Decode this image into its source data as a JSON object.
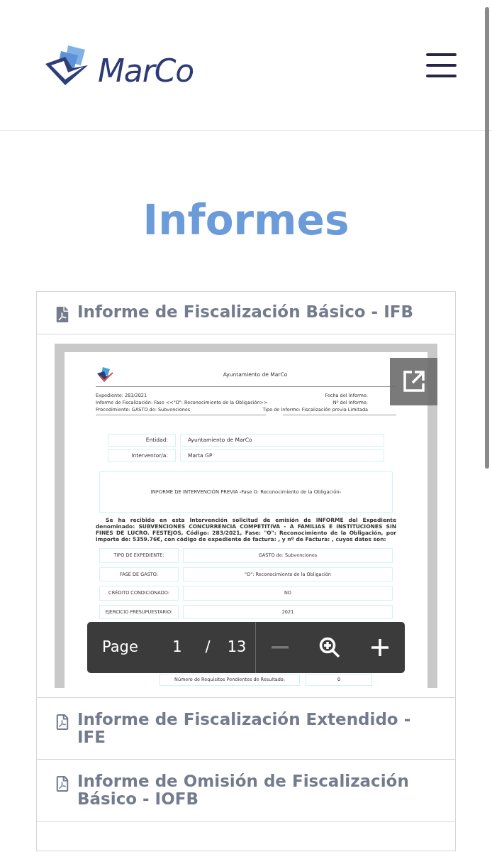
{
  "header": {
    "logo_text": "MarCo"
  },
  "page_title": "Informes",
  "reports": [
    {
      "title": "Informe de Fiscalización Básico - IFB",
      "expanded": true
    },
    {
      "title": "Informe de Fiscalización Extendido - IFE",
      "expanded": false
    },
    {
      "title": "Informe de Omisión de Fiscalización Básico - IOFB",
      "expanded": false
    }
  ],
  "document": {
    "org": "Ayuntamiento de MarCo",
    "meta_left": [
      "Expediente: 283/2021",
      "Informe de Fiscalización:  Fase <<\"O\": Reconocimiento de la Obligación>>",
      "Procedimiento: GASTO de: Subvenciones"
    ],
    "meta_right": [
      "Fecha del Informe:",
      "Nº del Informe:",
      "Tipo de Informe: Fiscalización previa Limitada"
    ],
    "parties": [
      {
        "label": "Entidad:",
        "value": "Ayuntamiento de MarCo"
      },
      {
        "label": "Interventor/a:",
        "value": "Marta GP"
      }
    ],
    "heading": "INFORME DE INTERVENCIÓN PREVIA -Fase O: Reconocimiento de la Obligación-",
    "intro": "Se ha recibido en esta Intervención solicitud de emisión de INFORME del Expediente denominado: SUBVENCIONES CONCURRENCIA COMPETITIVA - A FAMILIAS E INSTITUCIONES SIN FINES DE LUCRO. FESTEJOS, Código: 283/2021, Fase: \"O\": Reconocimiento de la Obligación, por importe de: 5359.76€, con código de expediente de factura: , y nº de Factura: , cuyos datos son:",
    "details": [
      {
        "label": "TIPO DE EXPEDIENTE:",
        "value": "GASTO de: Subvenciones"
      },
      {
        "label": "FASE DE GASTO:",
        "value": "\"O\": Reconocimiento de la Obligación"
      },
      {
        "label": "CRÉDITO CONDICIONADO:",
        "value": "NO"
      },
      {
        "label": "EJERCICIO PRESUPUESTARIO:",
        "value": "2021"
      }
    ],
    "summary_rows": [
      {
        "label": "Número de Requisitos Pendientes de Resultado:",
        "value": "0"
      }
    ]
  },
  "viewer_toolbar": {
    "page_label": "Page",
    "page": "1",
    "separator": "/",
    "total": "13",
    "zoom_out_enabled": false
  }
}
